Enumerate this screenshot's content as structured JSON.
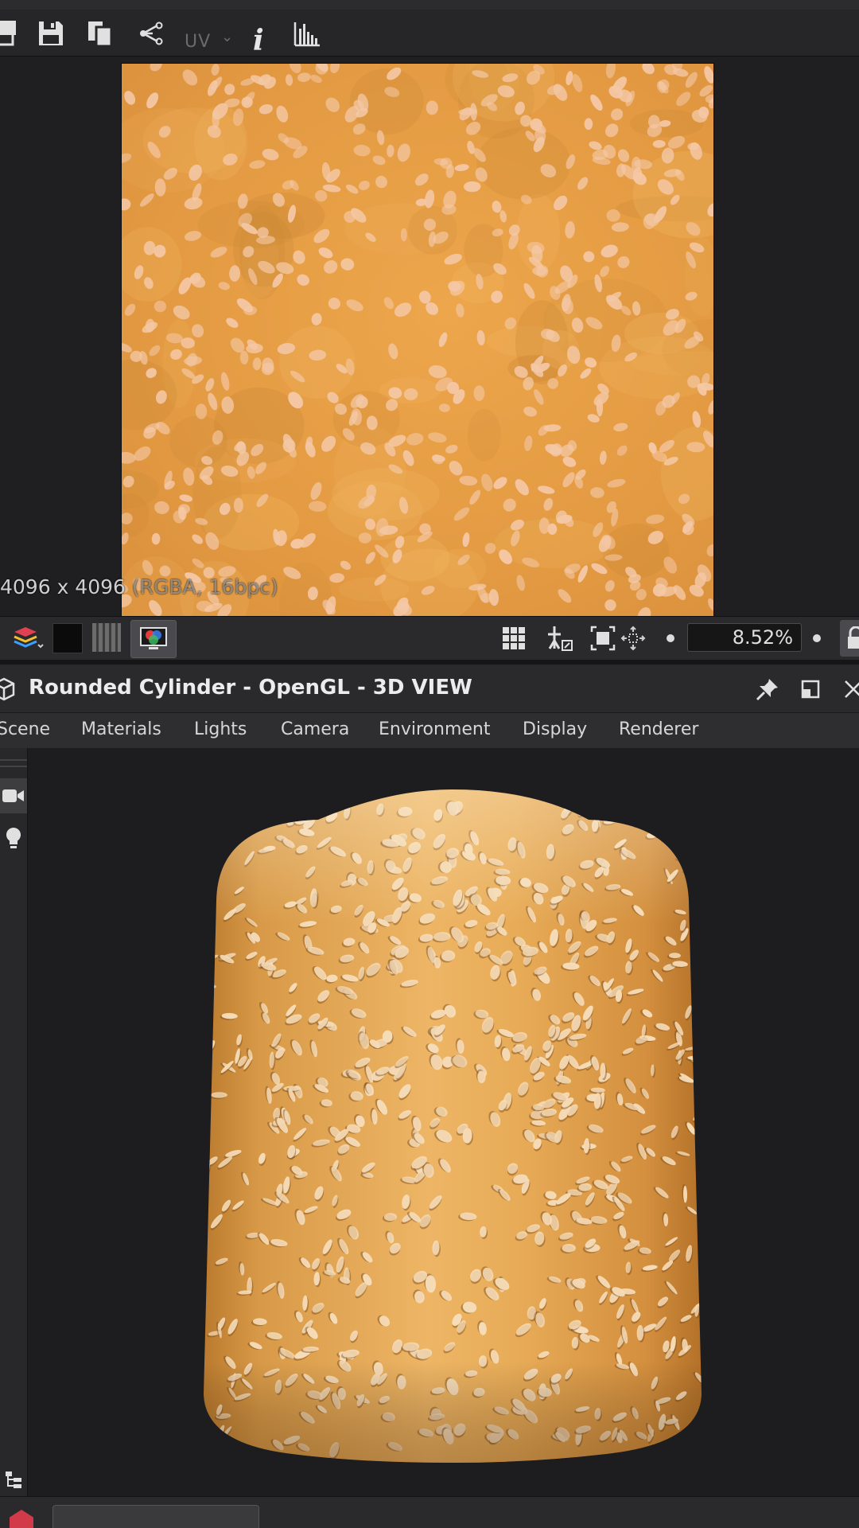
{
  "toolbar": {
    "uv_label": "UV",
    "uv_caret": "⌄",
    "info_glyph": "i",
    "icons": [
      "export-icon",
      "save-icon",
      "copy-icon",
      "graph-icon",
      "uv-dropdown",
      "info-icon",
      "histogram-icon"
    ]
  },
  "texture_view": {
    "info_main": "4096 x 4096",
    "info_detail": " (RGBA, 16bpc)",
    "colors": {
      "base": "#e8a048",
      "seed": "#f4c8a6"
    }
  },
  "texture_bar": {
    "zoom_value": "8.52%",
    "icons": [
      "layers-icon",
      "black-swatch",
      "channels-icon",
      "display-mode-icon",
      "grid-icon",
      "tiling-icon",
      "fit-icon",
      "center-icon",
      "zoom-out-dot",
      "zoom-in-dot",
      "lock-icon"
    ]
  },
  "view3d": {
    "title": "Rounded Cylinder - OpenGL - 3D VIEW",
    "menu": [
      "Scene",
      "Materials",
      "Lights",
      "Camera",
      "Environment",
      "Display",
      "Renderer"
    ],
    "icons": [
      "cube-icon",
      "pin-icon",
      "maximize-icon",
      "close-icon",
      "camera-icon",
      "light-bulb-icon",
      "hierarchy-icon"
    ]
  }
}
